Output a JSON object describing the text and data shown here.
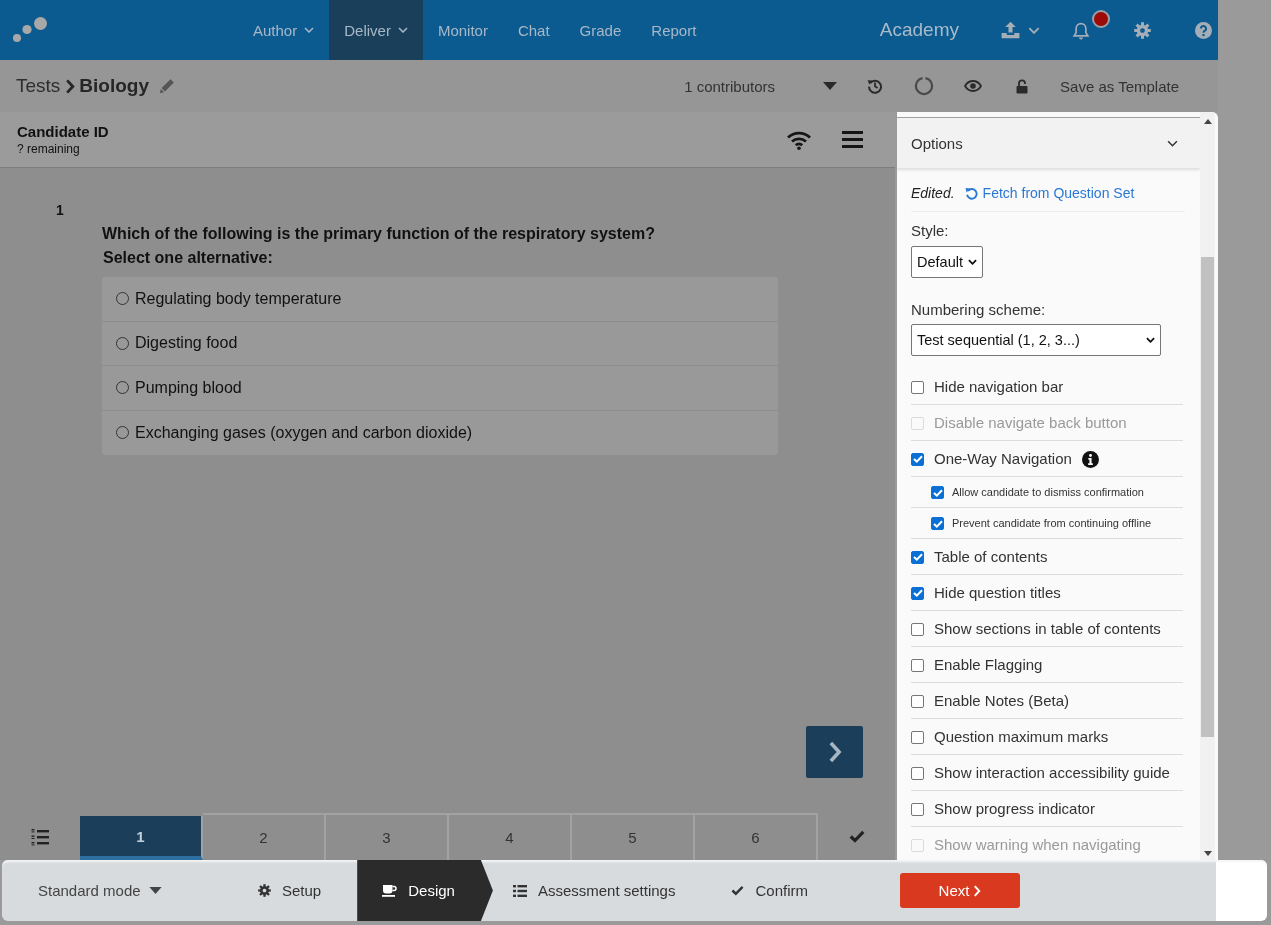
{
  "top_nav": {
    "menu": [
      {
        "label": "Author",
        "dropdown": true,
        "selected": false
      },
      {
        "label": "Deliver",
        "dropdown": true,
        "selected": true
      },
      {
        "label": "Monitor",
        "dropdown": false,
        "selected": false
      },
      {
        "label": "Chat",
        "dropdown": false,
        "selected": false
      },
      {
        "label": "Grade",
        "dropdown": false,
        "selected": false
      },
      {
        "label": "Report",
        "dropdown": false,
        "selected": false
      }
    ],
    "organization": "Academy",
    "notifications": {
      "unread": true
    }
  },
  "toolbar": {
    "section": "Tests",
    "title": "Biology",
    "contributors": "1 contributors",
    "save_template": "Save as Template"
  },
  "preview": {
    "candidate": "Candidate ID",
    "remaining": "? remaining",
    "question": {
      "number": "1",
      "text": "Which of the following is the primary function of the respiratory system?",
      "instruction": "Select one alternative:",
      "alternatives": [
        {
          "label": "Regulating body temperature",
          "selected": false
        },
        {
          "label": "Digesting food",
          "selected": false
        },
        {
          "label": "Pumping blood",
          "selected": false
        },
        {
          "label": "Exchanging gases (oxygen and carbon dioxide)",
          "selected": false
        }
      ]
    },
    "question_tabs": [
      {
        "label": "1",
        "selected": true
      },
      {
        "label": "2",
        "selected": false
      },
      {
        "label": "3",
        "selected": false
      },
      {
        "label": "4",
        "selected": false
      },
      {
        "label": "5",
        "selected": false
      },
      {
        "label": "6",
        "selected": false
      }
    ]
  },
  "options_panel": {
    "title": "Options",
    "edited": "Edited.",
    "fetch_link": "Fetch from Question Set",
    "style": {
      "label": "Style:",
      "value": "Default"
    },
    "numbering": {
      "label": "Numbering scheme:",
      "value": "Test sequential (1, 2, 3...)"
    },
    "checkboxes": [
      {
        "label": "Hide navigation bar",
        "checked": false,
        "disabled": false,
        "info": false
      },
      {
        "label": "Disable navigate back button",
        "checked": false,
        "disabled": true,
        "info": false
      },
      {
        "label": "One-Way Navigation",
        "checked": true,
        "disabled": false,
        "info": true,
        "children": [
          {
            "label": "Allow candidate to dismiss confirmation",
            "checked": true,
            "disabled": false,
            "info": false
          },
          {
            "label": "Prevent candidate from continuing offline",
            "checked": true,
            "disabled": false,
            "info": false
          }
        ]
      },
      {
        "label": "Table of contents",
        "checked": true,
        "disabled": false,
        "info": false
      },
      {
        "label": "Hide question titles",
        "checked": true,
        "disabled": false,
        "info": false
      },
      {
        "label": "Show sections in table of contents",
        "checked": false,
        "disabled": false,
        "info": false
      },
      {
        "label": "Enable Flagging",
        "checked": false,
        "disabled": false,
        "info": false
      },
      {
        "label": "Enable Notes (Beta)",
        "checked": false,
        "disabled": false,
        "info": false
      },
      {
        "label": "Question maximum marks",
        "checked": false,
        "disabled": false,
        "info": false
      },
      {
        "label": "Show interaction accessibility guide",
        "checked": false,
        "disabled": false,
        "info": false
      },
      {
        "label": "Show progress indicator",
        "checked": false,
        "disabled": false,
        "info": false
      },
      {
        "label": "Show warning when navigating",
        "checked": false,
        "disabled": true,
        "info": false
      }
    ]
  },
  "wizard": {
    "mode": "Standard mode",
    "steps": [
      {
        "label": "Setup",
        "selected": false
      },
      {
        "label": "Design",
        "selected": true
      },
      {
        "label": "Assessment settings",
        "selected": false
      },
      {
        "label": "Confirm",
        "selected": false
      }
    ],
    "next": "Next"
  }
}
